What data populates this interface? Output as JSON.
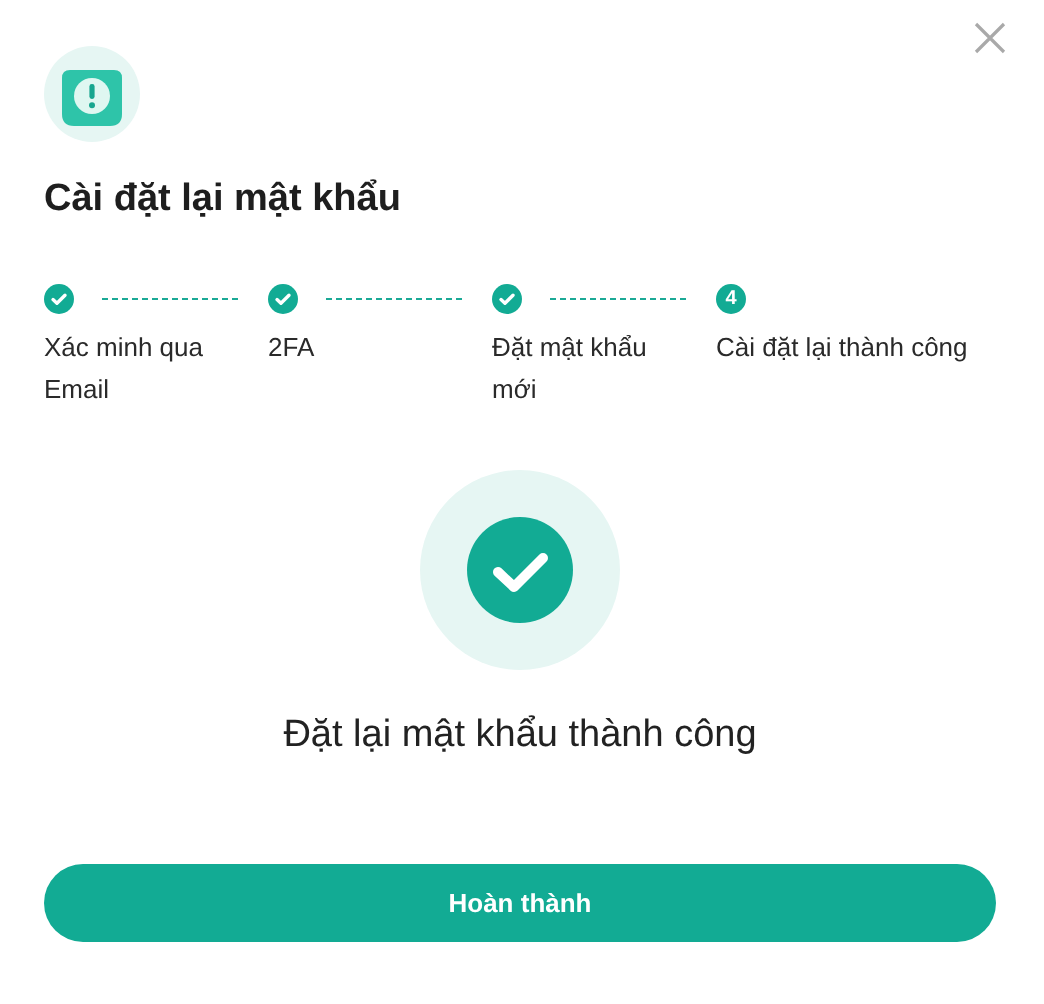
{
  "dialog": {
    "title": "Cài đặt lại mật khẩu"
  },
  "steps": [
    {
      "label": "Xác minh qua Email",
      "done": true
    },
    {
      "label": "2FA",
      "done": true
    },
    {
      "label": "Đặt mật khẩu mới",
      "done": true
    },
    {
      "label": "Cài đặt lại thành công",
      "number": "4",
      "done": false
    }
  ],
  "result": {
    "message": "Đặt lại mật khẩu thành công"
  },
  "buttons": [
    "Hoàn thành"
  ]
}
